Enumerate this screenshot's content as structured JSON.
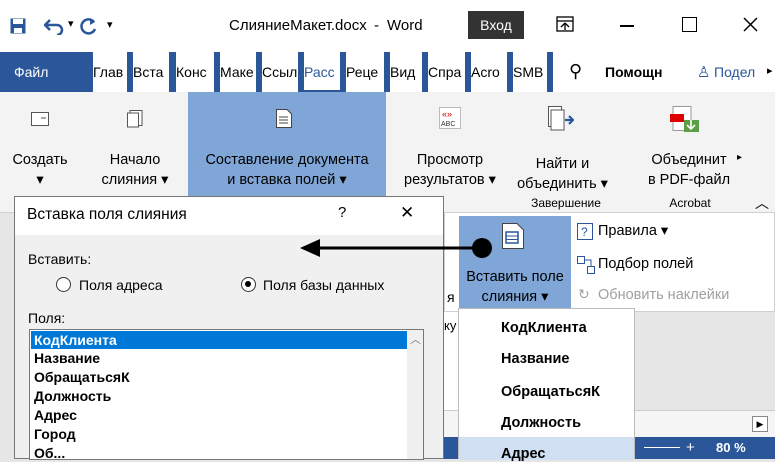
{
  "titlebar": {
    "filename": "СлияниеМакет.docx",
    "separator": "-",
    "app": "Word",
    "signin": "Вход"
  },
  "tabs": [
    "Файл",
    "Глав",
    "Вста",
    "Конс",
    "Маке",
    "Ссыл",
    "Расс",
    "Реце",
    "Вид",
    "Спра",
    "Acro",
    "SMB",
    "Помощн",
    "Подел"
  ],
  "ribbon": {
    "create": "Создать",
    "start_merge_1": "Начало",
    "start_merge_2": "слияния ▾",
    "compose_1": "Составление документа",
    "compose_2": "и вставка полей ▾",
    "preview_1": "Просмотр",
    "preview_2": "результатов ▾",
    "find_1": "Найти и",
    "find_2": "объединить ▾",
    "finish_group": "Завершение",
    "pdf_1": "Объединит",
    "pdf_2": "в PDF-файл",
    "acrobat_group": "Acrobat",
    "rules": "Правила ▾",
    "match_fields": "Подбор полей",
    "update_labels": "Обновить наклейки",
    "insert_field_1": "Вставить поле",
    "insert_field_2": "слияния ▾"
  },
  "dialog": {
    "title": "Вставка поля слияния",
    "help": "?",
    "close": "✕",
    "insert_label": "Вставить:",
    "radio_address": "Поля адреса",
    "radio_db": "Поля базы данных",
    "fields_label": "Поля:",
    "fields": [
      "КодКлиента",
      "Название",
      "ОбращатьсяК",
      "Должность",
      "Адрес",
      "Город"
    ],
    "fields_partial": "Об..."
  },
  "menu": {
    "items": [
      "КодКлиента",
      "Название",
      "ОбращатьсяК",
      "Должность",
      "Адрес"
    ]
  },
  "behind": {
    "fragment_ya": "я",
    "fragment_ku": "ку"
  },
  "status": {
    "zoom": "80 %",
    "plus": "+"
  },
  "colors": {
    "ribbon_blue": "#2b579a",
    "selected": "#7fa6d6",
    "list_highlight": "#0078d7",
    "menu_highlight": "#d0dff2"
  }
}
